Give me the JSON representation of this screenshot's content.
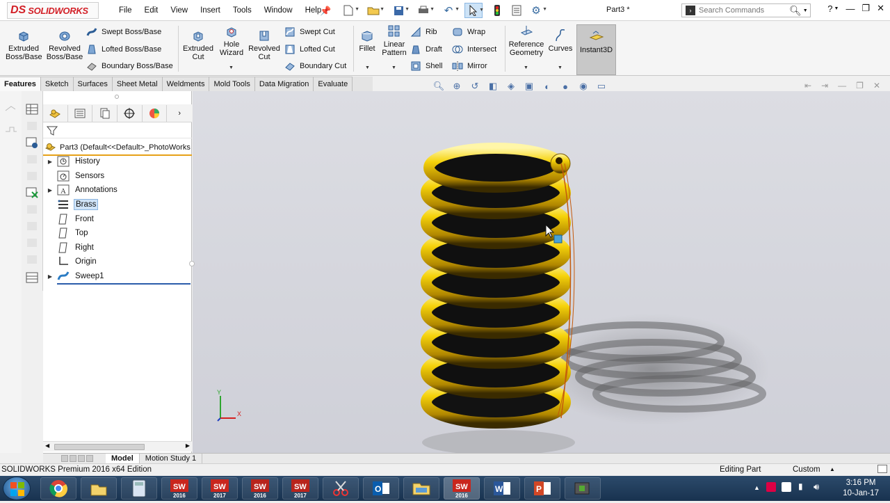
{
  "app": {
    "logo_ds": "DS",
    "logo_text": "SOLIDWORKS",
    "doc_title": "Part3 *",
    "search_placeholder": "Search Commands"
  },
  "menu": [
    "File",
    "Edit",
    "View",
    "Insert",
    "Tools",
    "Window",
    "Help"
  ],
  "ribbon": {
    "extruded_boss": [
      "Extruded",
      "Boss/Base"
    ],
    "revolved_boss": [
      "Revolved",
      "Boss/Base"
    ],
    "swept_boss": "Swept Boss/Base",
    "lofted_boss": "Lofted Boss/Base",
    "boundary_boss": "Boundary Boss/Base",
    "extruded_cut": [
      "Extruded",
      "Cut"
    ],
    "hole_wizard": [
      "Hole",
      "Wizard"
    ],
    "revolved_cut": [
      "Revolved",
      "Cut"
    ],
    "swept_cut": "Swept Cut",
    "lofted_cut": "Lofted Cut",
    "boundary_cut": "Boundary Cut",
    "fillet": "Fillet",
    "linear_pattern": [
      "Linear",
      "Pattern"
    ],
    "rib": "Rib",
    "draft": "Draft",
    "shell": "Shell",
    "wrap": "Wrap",
    "intersect": "Intersect",
    "mirror": "Mirror",
    "ref_geometry": [
      "Reference",
      "Geometry"
    ],
    "curves": "Curves",
    "instant3d": "Instant3D"
  },
  "tabs": [
    "Features",
    "Sketch",
    "Surfaces",
    "Sheet Metal",
    "Weldments",
    "Mold Tools",
    "Data Migration",
    "Evaluate"
  ],
  "tree": {
    "root": "Part3  (Default<<Default>_PhotoWorks",
    "items": [
      {
        "label": "History",
        "expand": true
      },
      {
        "label": "Sensors",
        "expand": false
      },
      {
        "label": "Annotations",
        "expand": true
      },
      {
        "label": "Brass",
        "expand": false,
        "selected": true
      },
      {
        "label": "Front",
        "expand": false
      },
      {
        "label": "Top",
        "expand": false
      },
      {
        "label": "Right",
        "expand": false
      },
      {
        "label": "Origin",
        "expand": false
      },
      {
        "label": "Sweep1",
        "expand": true
      }
    ]
  },
  "triad": {
    "y": "Y",
    "x": "X"
  },
  "bottom_tabs": [
    "Model",
    "Motion Study 1"
  ],
  "status": {
    "edition": "SOLIDWORKS Premium 2016 x64 Edition",
    "mode": "Editing Part",
    "units": "Custom"
  },
  "taskbar": {
    "apps": [
      "Chrome",
      "Explorer files",
      "Calculator",
      "SW 2016",
      "SW 2017",
      "SW 2016",
      "SW 2017",
      "Snipping",
      "Outlook",
      "Folders",
      "SW 2016",
      "Word",
      "PowerPoint",
      "Camtasia"
    ],
    "sw_label_2016": "2016",
    "sw_label_2017": "2017",
    "time": "3:16 PM",
    "date": "10-Jan-17"
  },
  "colors": {
    "accent": "#d32027",
    "spring_gold": "#f5d20a",
    "selection": "#cfe3f7",
    "tree_underline": "#e6a117"
  }
}
